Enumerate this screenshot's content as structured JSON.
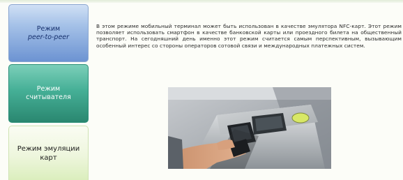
{
  "tabs": [
    {
      "line1": "Режим",
      "line2": "peer-to-peer",
      "state": "inactive"
    },
    {
      "line1": "Режим",
      "line2": "считывателя",
      "state": "inactive"
    },
    {
      "line1": "Режим эмуляции",
      "line2": "карт",
      "state": "active"
    }
  ],
  "content": {
    "text": "В этом режиме мобильный терминал может быть использован в качестве эмулятора NFC-карт. Этот режим позволяет использовать смартфон в качестве банковской карты или проездного билета на общественный транспорт. На сегодняшний день именно этот режим считается самым перспективным, вызывающим особенный интерес со стороны операторов сотовой связи и международных платежных систем.",
    "image": "turnstile-nfc-photo"
  },
  "colors": {
    "tab_blue": "#6c93d2",
    "tab_teal": "#45af96",
    "tab_active": "#eef6dd",
    "background": "#fcfdf8"
  }
}
